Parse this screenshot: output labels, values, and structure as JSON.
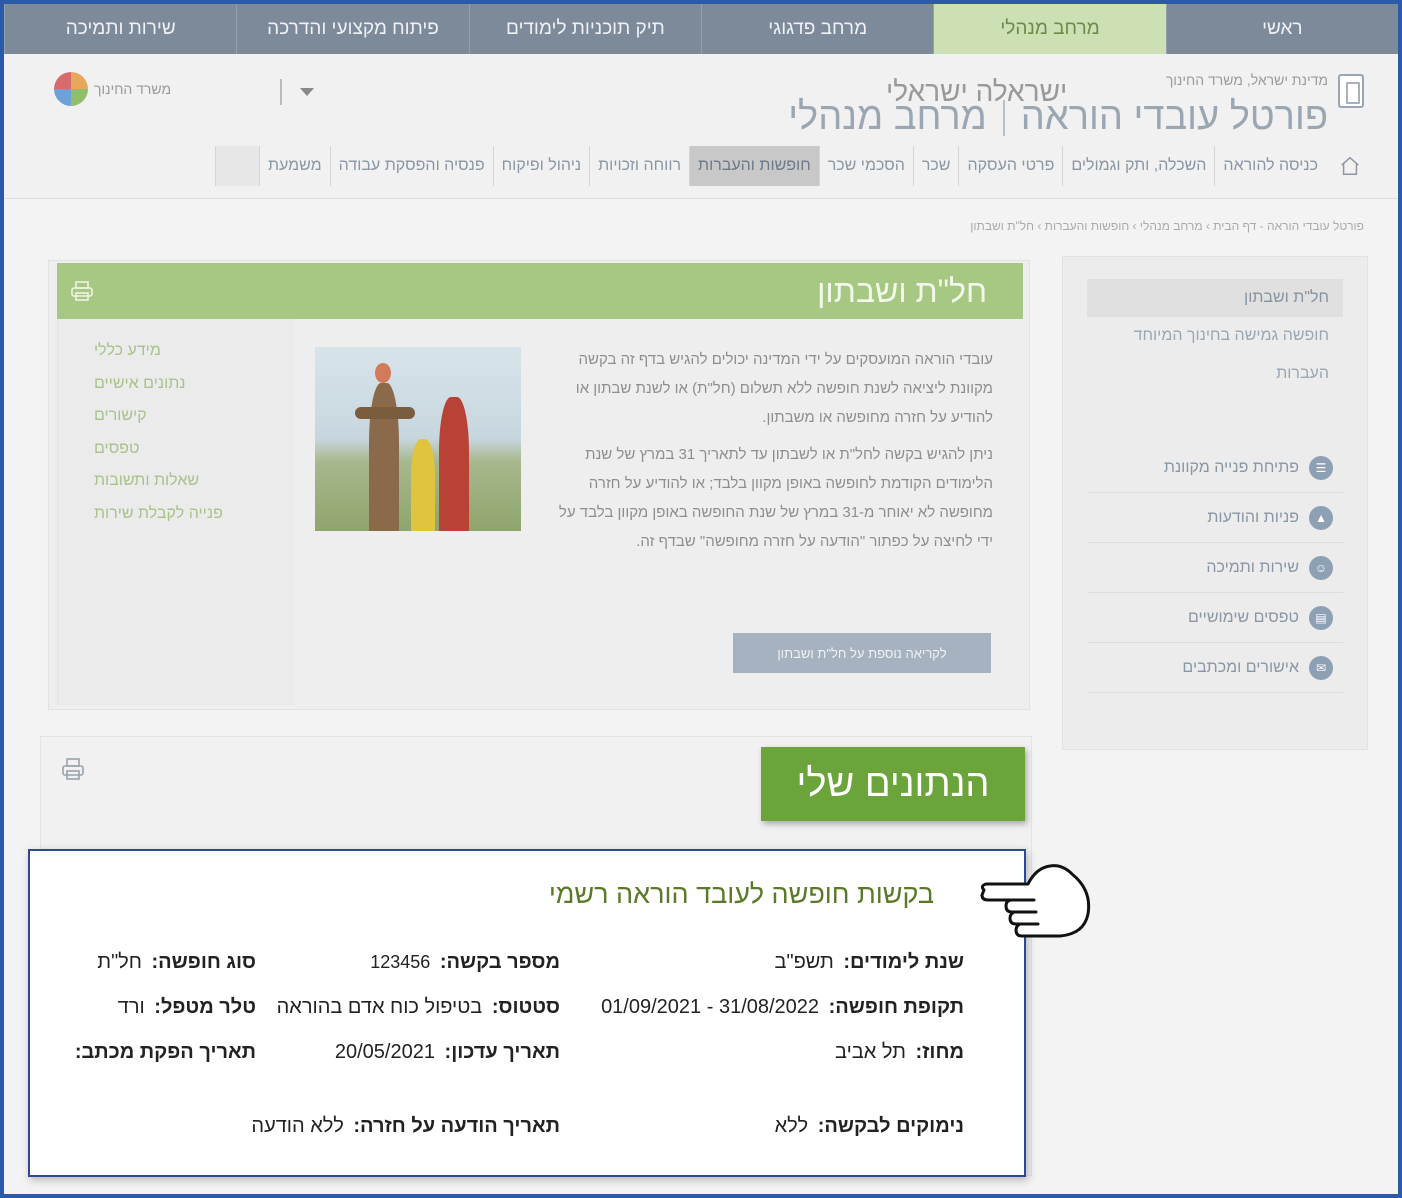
{
  "top_tabs": [
    "ראשי",
    "מרחב מנהלי",
    "מרחב פדגוגי",
    "תיק תוכניות לימודים",
    "פיתוח מקצועי והדרכה",
    "שירות ותמיכה"
  ],
  "header": {
    "state_line": "מדינת ישראל, משרד החינוך",
    "portal": "פורטל עובדי הוראה",
    "area": "מרחב מנהלי",
    "user": "ישראלה ישראלי",
    "ministry": "משרד החינוך"
  },
  "subnav": [
    "כניסה להוראה",
    "השכלה, ותק וגמולים",
    "פרטי העסקה",
    "שכר",
    "הסכמי שכר",
    "חופשות והעברות",
    "רווחה וזכויות",
    "ניהול ופיקוח",
    "פנסיה והפסקת עבודה",
    "משמעת"
  ],
  "breadcrumb": "פורטל עובדי הוראה - דף הבית › מרחב מנהלי › חופשות והעברות › חל\"ת ושבתון",
  "sidebar": {
    "links": [
      "חל\"ת ושבתון",
      "חופשה גמישה בחינוך המיוחד",
      "העברות"
    ],
    "actions": [
      "פתיחת פנייה מקוונת",
      "פניות והודעות",
      "שירות ותמיכה",
      "טפסים שימושיים",
      "אישורים ומכתבים"
    ]
  },
  "card": {
    "title": "חל\"ת ושבתון",
    "para1": "עובדי הוראה המועסקים על ידי המדינה יכולים להגיש בדף זה בקשה מקוונת ליציאה לשנת חופשה ללא תשלום (חל\"ת) או לשנת שבתון או להודיע על חזרה מחופשה או משבתון.",
    "para2": "ניתן להגיש בקשה לחל\"ת או לשבתון עד לתאריך 31 במרץ של שנת הלימודים הקודמת לחופשה באופן מקוון בלבד; או להודיע על חזרה מחופשה לא יאוחר מ-31 במרץ של שנת החופשה באופן מקוון בלבד על ידי לחיצה על כפתור \"הודעה על חזרה מחופשה\" שבדף זה.",
    "more_button": "לקריאה נוספת על חל\"ת ושבתון",
    "side_links": [
      "מידע כללי",
      "נתונים אישיים",
      "קישורים",
      "טפסים",
      "שאלות ותשובות",
      "פנייה לקבלת שירות"
    ]
  },
  "my_data": {
    "title": "הנתונים שלי"
  },
  "panel": {
    "title": "בקשות חופשה לעובד הוראה רשמי",
    "school_year_label": "שנת לימודים:",
    "school_year": "תשפ\"ב",
    "request_no_label": "מספר בקשה:",
    "request_no": "123456",
    "leave_type_label": "סוג חופשה:",
    "leave_type": "חל\"ת",
    "period_label": "תקופת חופשה:",
    "period": "31/08/2022 - 01/09/2021",
    "status_label": "סטטוס:",
    "status": "בטיפול כוח אדם בהוראה",
    "handler_label": "טלר מטפל:",
    "handler": "ורד",
    "district_label": "מחוז:",
    "district": "תל אביב",
    "updated_label": "תאריך עדכון:",
    "updated": "20/05/2021",
    "letter_date_label": "תאריך הפקת מכתב:",
    "reasons_label": "נימוקים לבקשה:",
    "reasons": "ללא",
    "return_notice_label": "תאריך הודעה על חזרה:",
    "return_notice": "ללא הודעה"
  },
  "colors": {
    "accent_green": "#6aa43a",
    "frame_blue": "#2a5aa8",
    "topnav": "#7c8a99"
  }
}
